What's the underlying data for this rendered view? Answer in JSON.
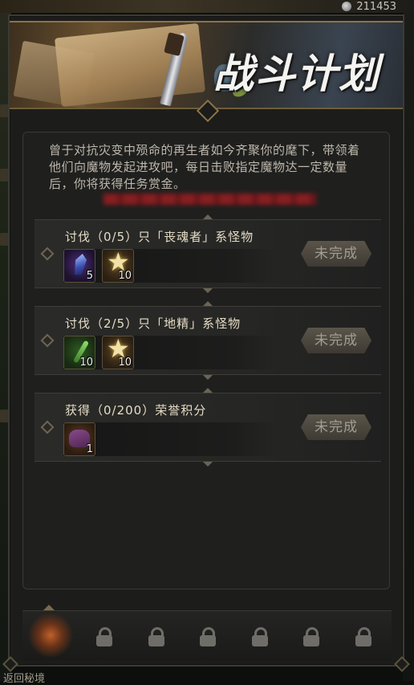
{
  "header": {
    "currency_value": "211453"
  },
  "banner": {
    "title": "战斗计划"
  },
  "intro": {
    "text": "曾于对抗灾变中殒命的再生者如今齐聚你的麾下，带领着他们向魔物发起进攻吧，每日击败指定魔物达一定数量后，你将获得任务赏金。"
  },
  "tasks": [
    {
      "title": "讨伐（0/5）只「丧魂者」系怪物",
      "status": "未完成",
      "rewards": [
        {
          "icon": "crystal-icon",
          "qty": "5"
        },
        {
          "icon": "star-icon",
          "qty": "10"
        }
      ]
    },
    {
      "title": "讨伐（2/5）只「地精」系怪物",
      "status": "未完成",
      "rewards": [
        {
          "icon": "wand-icon",
          "qty": "10"
        },
        {
          "icon": "star-icon",
          "qty": "10"
        }
      ]
    },
    {
      "title": "获得（0/200）荣誉积分",
      "status": "未完成",
      "rewards": [
        {
          "icon": "bag-icon",
          "qty": "1"
        }
      ]
    }
  ],
  "tabs": {
    "active_icon": "flame-icon",
    "locked_icon": "lock-icon",
    "locked_count": 6
  },
  "footer": {
    "left_text": "返回秘境"
  },
  "colors": {
    "panel_bg": "#1c1c1b",
    "gold_border": "#8a7448",
    "text_light": "#e5dcc6",
    "button_text": "#a29e94",
    "redacted_red": "#a21e22"
  }
}
